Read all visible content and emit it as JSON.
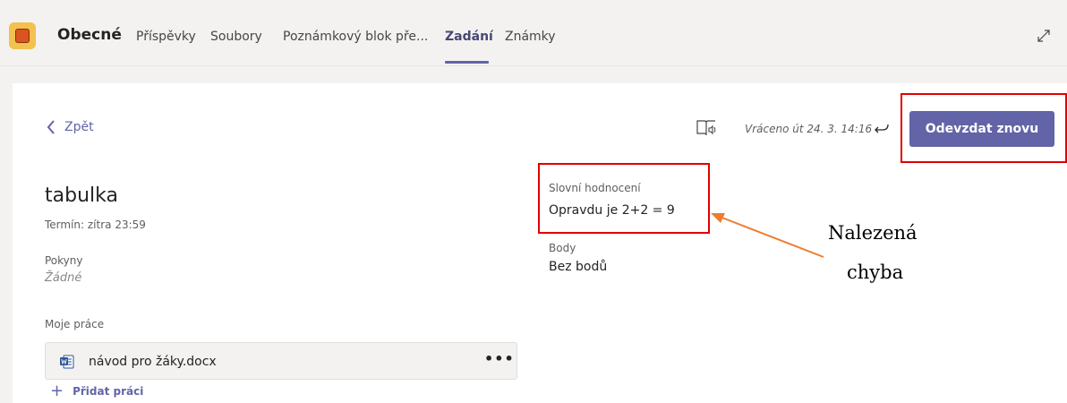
{
  "header": {
    "team_name": "Obecné",
    "tabs": [
      {
        "label": "Příspěvky"
      },
      {
        "label": "Soubory"
      },
      {
        "label": "Poznámkový blok pře..."
      },
      {
        "label": "Zadání",
        "active": true
      },
      {
        "label": "Známky"
      }
    ],
    "accent_color": "#6264a7"
  },
  "nav": {
    "back_label": "Zpět"
  },
  "status": {
    "returned_text": "Vráceno út 24. 3. 14:16"
  },
  "actions": {
    "resubmit_label": "Odevzdat znovu"
  },
  "assignment": {
    "title": "tabulka",
    "due": "Termín: zítra 23:59",
    "instructions_label": "Pokyny",
    "instructions_value": "Žádné",
    "my_work_label": "Moje práce",
    "files": [
      {
        "name": "návod pro žáky.docx",
        "icon": "word-doc-icon"
      }
    ],
    "add_work_label": "Přidat práci"
  },
  "feedback": {
    "label": "Slovní hodnocení",
    "value": "Opravdu je 2+2 = 9",
    "points_label": "Body",
    "points_value": "Bez bodů"
  },
  "annotation": {
    "line1": "Nalezená",
    "line2": "chyba",
    "highlight_color": "#e00000",
    "arrow_color": "#ed7d31"
  }
}
